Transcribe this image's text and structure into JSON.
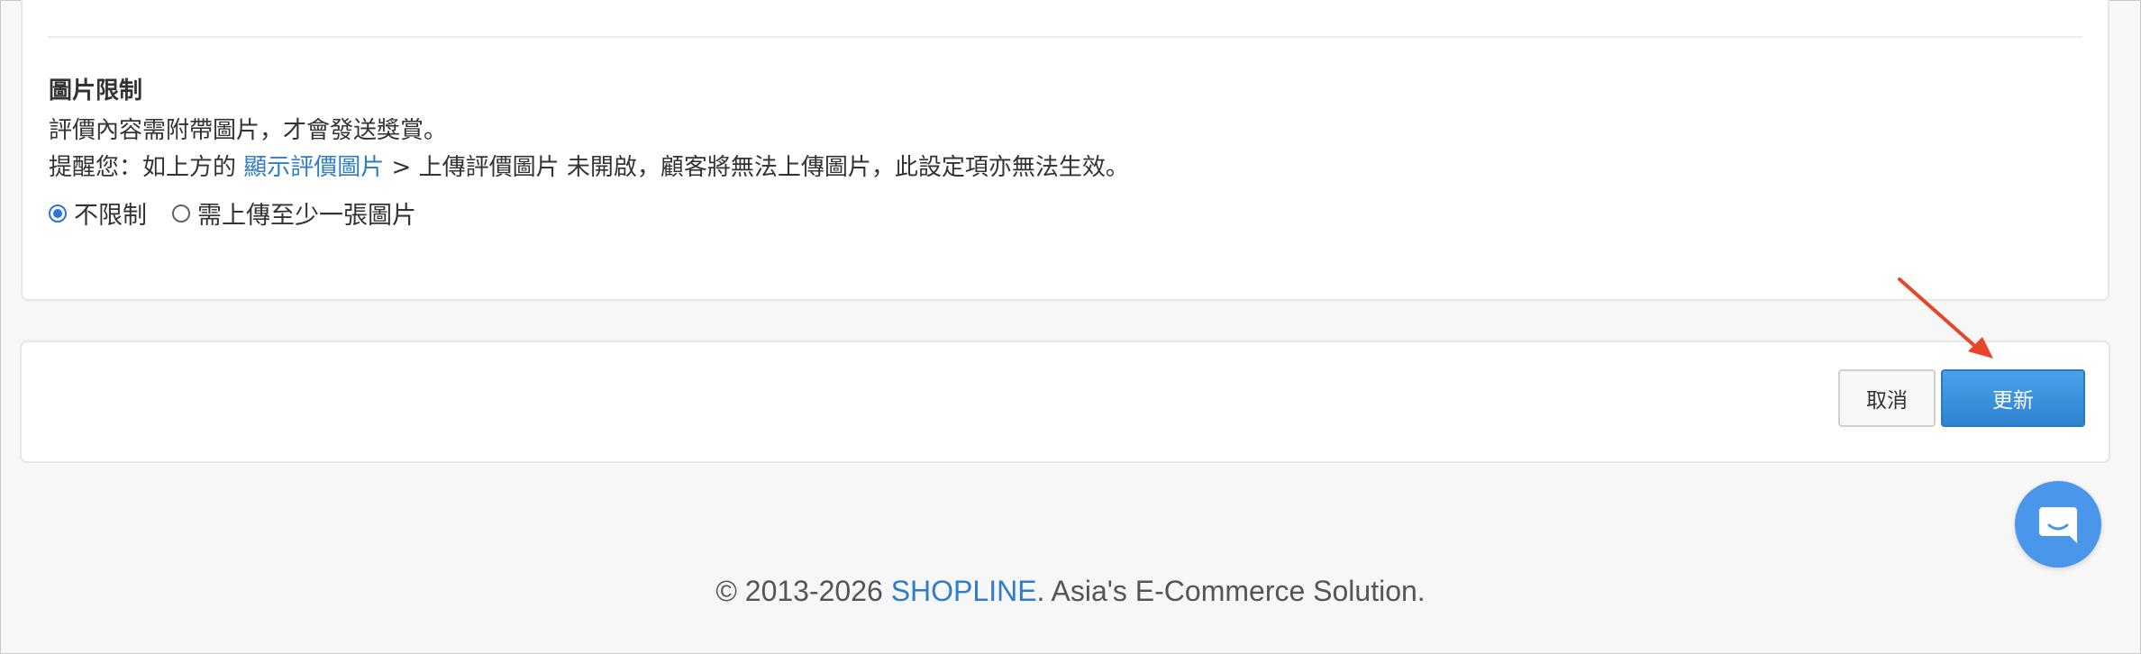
{
  "image_restriction": {
    "title": "圖片限制",
    "description": "評價內容需附帶圖片，才會發送獎賞。",
    "reminder_prefix": "提醒您：如上方的 ",
    "reminder_link": "顯示評價圖片",
    "reminder_suffix": " > 上傳評價圖片 未開啟，顧客將無法上傳圖片，此設定項亦無法生效。",
    "options": [
      {
        "label": "不限制",
        "selected": true
      },
      {
        "label": "需上傳至少一張圖片",
        "selected": false
      }
    ]
  },
  "actions": {
    "cancel_label": "取消",
    "update_label": "更新"
  },
  "footer": {
    "prefix": "© 2013-2026 ",
    "brand": "SHOPLINE",
    "suffix": ". Asia's E-Commerce Solution."
  },
  "icons": {
    "chat": "chat-bubble-icon",
    "annotation": "red-arrow-annotation"
  },
  "colors": {
    "accent": "#2f7dc4",
    "update_button": "#3a8ede",
    "annotation_arrow": "#e8452c",
    "chat_bubble": "#4a96ea"
  }
}
